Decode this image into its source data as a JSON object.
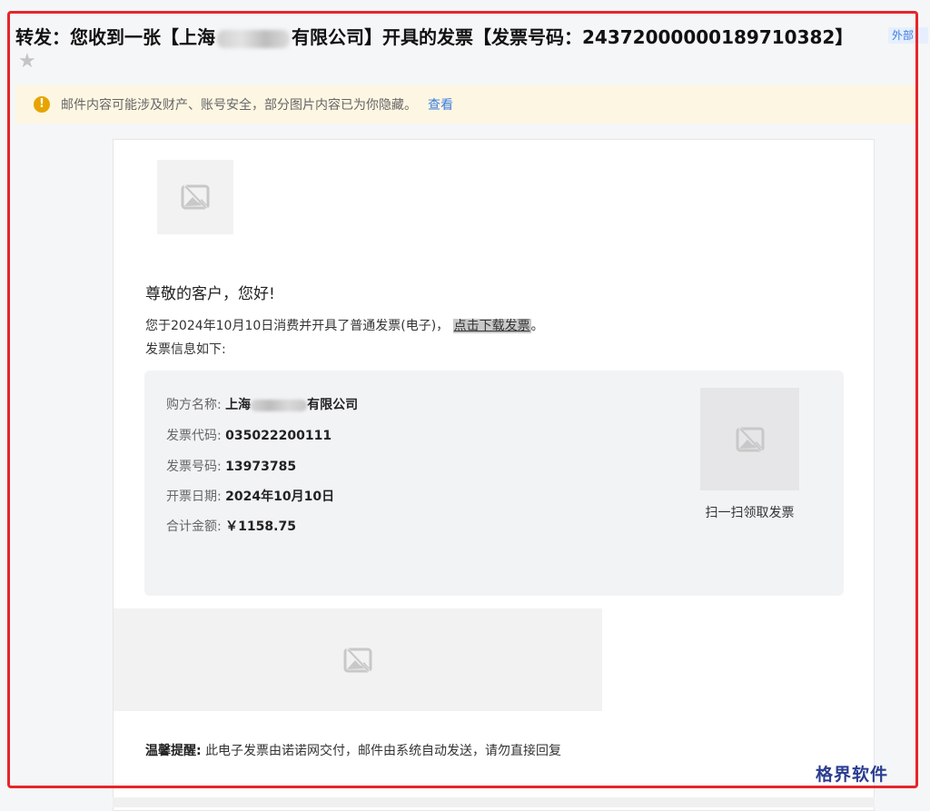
{
  "email": {
    "subject_prefix": "转发：您收到一张【上海",
    "subject_suffix": "有限公司】开具的发票【发票号码：24372000000189710382】",
    "external_tag": "外部",
    "star_glyph": "★"
  },
  "notice": {
    "icon": "!",
    "text": "邮件内容可能涉及财产、账号安全，部分图片内容已为你隐藏。",
    "link": "查看"
  },
  "body": {
    "greeting": "尊敬的客户，您好!",
    "line1_text": "您于2024年10月10日消费并开具了普通发票(电子)，",
    "line1_link": "点击下载发票",
    "line1_end": "。",
    "line2": "发票信息如下:"
  },
  "invoice": {
    "buyer_label": "购方名称:",
    "buyer_value_prefix": "上海",
    "buyer_value_suffix": "有限公司",
    "code_label": "发票代码:",
    "code_value": "035022200111",
    "number_label": "发票号码:",
    "number_value": "13973785",
    "date_label": "开票日期:",
    "date_value": "2024年10月10日",
    "total_label": "合计金额:",
    "total_value": "￥1158.75",
    "qr_caption": "扫一扫领取发票"
  },
  "tip": {
    "title": "温馨提醒:",
    "text": "此电子发票由诺诺网交付，邮件由系统自动发送，请勿直接回复"
  },
  "watermark": "格界软件",
  "colors": {
    "highlight_frame": "#e5262b",
    "link": "#3b7ddd",
    "warning": "#e7a400",
    "notice_bg": "#fdf6e3"
  }
}
